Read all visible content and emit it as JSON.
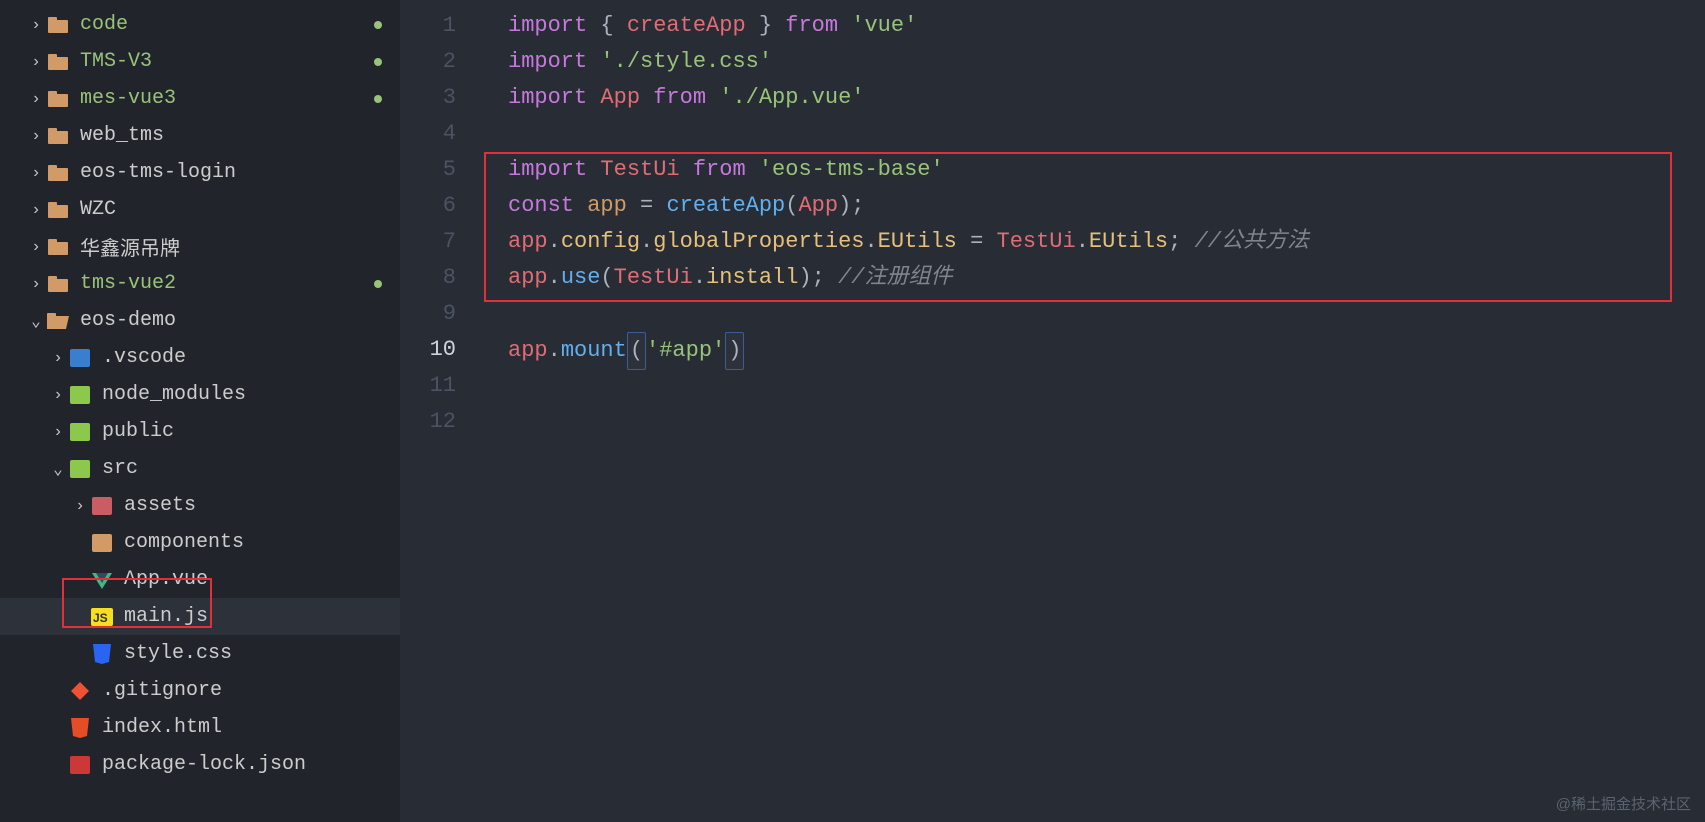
{
  "explorer": {
    "items": [
      {
        "chev": "›",
        "indent": 0,
        "icon": "folder-orange",
        "label": "code",
        "green": true,
        "dot": true
      },
      {
        "chev": "›",
        "indent": 0,
        "icon": "folder-orange",
        "label": "TMS-V3",
        "green": true,
        "dot": true
      },
      {
        "chev": "›",
        "indent": 0,
        "icon": "folder-orange",
        "label": "mes-vue3",
        "green": true,
        "dot": true
      },
      {
        "chev": "›",
        "indent": 0,
        "icon": "folder-orange",
        "label": "web_tms",
        "green": false,
        "dot": false
      },
      {
        "chev": "›",
        "indent": 0,
        "icon": "folder-orange",
        "label": "eos-tms-login",
        "green": false,
        "dot": false
      },
      {
        "chev": "›",
        "indent": 0,
        "icon": "folder-orange",
        "label": "WZC",
        "green": false,
        "dot": false
      },
      {
        "chev": "›",
        "indent": 0,
        "icon": "folder-orange",
        "label": "华鑫源吊牌",
        "green": false,
        "dot": false
      },
      {
        "chev": "›",
        "indent": 0,
        "icon": "folder-orange",
        "label": "tms-vue2",
        "green": true,
        "dot": true
      },
      {
        "chev": "⌄",
        "indent": 0,
        "icon": "folder-open",
        "label": "eos-demo",
        "green": false,
        "dot": false
      },
      {
        "chev": "›",
        "indent": 1,
        "icon": "vscode",
        "label": ".vscode",
        "green": false,
        "dot": false
      },
      {
        "chev": "›",
        "indent": 1,
        "icon": "node",
        "label": "node_modules",
        "green": false,
        "dot": false
      },
      {
        "chev": "›",
        "indent": 1,
        "icon": "public",
        "label": "public",
        "green": false,
        "dot": false
      },
      {
        "chev": "⌄",
        "indent": 1,
        "icon": "src",
        "label": "src",
        "green": false,
        "dot": false
      },
      {
        "chev": "›",
        "indent": 2,
        "icon": "assets",
        "label": "assets",
        "green": false,
        "dot": false
      },
      {
        "chev": " ",
        "indent": 2,
        "icon": "components",
        "label": "components",
        "green": false,
        "dot": false
      },
      {
        "chev": " ",
        "indent": 2,
        "icon": "vue",
        "label": "App.vue",
        "green": false,
        "dot": false
      },
      {
        "chev": " ",
        "indent": 2,
        "icon": "js",
        "label": "main.js",
        "green": false,
        "dot": false,
        "active": true,
        "highlighted": true
      },
      {
        "chev": " ",
        "indent": 2,
        "icon": "css",
        "label": "style.css",
        "green": false,
        "dot": false
      },
      {
        "chev": " ",
        "indent": 1,
        "icon": "git",
        "label": ".gitignore",
        "green": false,
        "dot": false
      },
      {
        "chev": " ",
        "indent": 1,
        "icon": "html",
        "label": "index.html",
        "green": false,
        "dot": false
      },
      {
        "chev": " ",
        "indent": 1,
        "icon": "npm",
        "label": "package-lock.json",
        "green": false,
        "dot": false
      }
    ]
  },
  "code": {
    "current_line": 10,
    "lines": [
      "1",
      "2",
      "3",
      "4",
      "5",
      "6",
      "7",
      "8",
      "9",
      "10",
      "11",
      "12"
    ],
    "tokens": {
      "l1": {
        "import": "import",
        "brace_o": "{",
        "createApp": "createApp",
        "brace_c": "}",
        "from": "from",
        "vue": "'vue'"
      },
      "l2": {
        "import": "import",
        "style": "'./style.css'"
      },
      "l3": {
        "import": "import",
        "App": "App",
        "from": "from",
        "appvue": "'./App.vue'"
      },
      "l5": {
        "import": "import",
        "TestUi": "TestUi",
        "from": "from",
        "pkg": "'eos-tms-base'"
      },
      "l6": {
        "const": "const",
        "app": "app",
        "eq": "=",
        "createApp": "createApp",
        "paren_o": "(",
        "App": "App",
        "paren_c": ")",
        "semi": ";"
      },
      "l7": {
        "appv": "app",
        "dot1": ".",
        "config": "config",
        "dot2": ".",
        "globalProperties": "globalProperties",
        "dot3": ".",
        "EUtils": "EUtils",
        "eq": " = ",
        "TestUi": "TestUi",
        "dot4": ".",
        "EUtils2": "EUtils",
        "semi": ";",
        "comment": " //公共方法"
      },
      "l8": {
        "appv": "app",
        "dot1": ".",
        "use": "use",
        "paren_o": "(",
        "TestUi": "TestUi",
        "dot2": ".",
        "install": "install",
        "paren_c": ")",
        "semi": ";",
        "comment": " //注册组件"
      },
      "l10": {
        "appv": "app",
        "dot1": ".",
        "mount": "mount",
        "paren_o": "(",
        "happ": "'#app'",
        "paren_c": ")"
      }
    }
  },
  "watermark": "@稀土掘金技术社区"
}
